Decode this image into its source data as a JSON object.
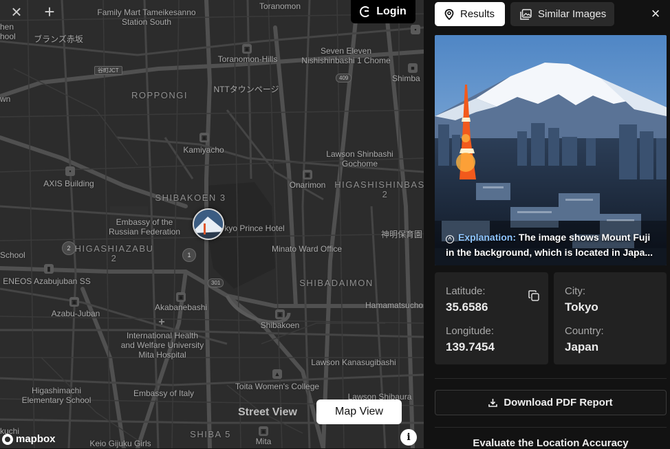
{
  "map": {
    "controls": {
      "close_icon": "close-icon",
      "add_icon": "plus-icon"
    },
    "login_label": "Login",
    "street_view_label": "Street View",
    "map_view_label": "Map View",
    "mapbox_label": "mapbox",
    "info_symbol": "i",
    "labels": {
      "family_mart": "Family Mart Tameikesanno\nStation South",
      "toranomon": "Toranomon",
      "hen": "hen",
      "school_top": "hool",
      "burands": "ブランズ赤坂",
      "toranomon_hills": "Toranomon-Hills",
      "seven_eleven": "Seven Eleven\nNishishinbashi 1 Chome",
      "shimba": "Shimba",
      "roppongi": "ROPPONGI",
      "ntt": "NTTタウンページ",
      "wn": "wn",
      "kamiyacho": "Kamiyacho",
      "lawson_shinbashi": "Lawson Shinbashi\nGochome",
      "axis": "AXIS Building",
      "onarimon": "Onarimon",
      "higashishinbashi": "HIGASHISHINBASHI\n2",
      "shibakoen3": "SHIBAKOEN 3",
      "embassy_fed": "Embassy of the\nRussian Federation",
      "prince_hotel": "kyo Prince Hotel",
      "jinmei": "神明保育園",
      "higashiazabu": "HIGASHIAZABU\n2",
      "minato_ward": "Minato Ward Office",
      "school_left": "School",
      "eneos": "ENEOS Azabujuban SS",
      "shibadaimon": "SHIBADAIMON",
      "akabanebashi": "Akabanebashi",
      "hamamatsucho": "Hamamatsucho",
      "azabu_juban": "Azabu-Juban",
      "shibakoen": "Shibakoen",
      "iuhw": "International Health\nand Welfare University\nMita Hospital",
      "lawson_kanasugi": "Lawson Kanasugibashi",
      "toita": "Toita Women's College",
      "higashimachi": "Higashimachi\nElementary School",
      "embassy_italy": "Embassy of Italy",
      "lawson_shibaura": "Lawson Shibaura",
      "kuchi": "kuchi",
      "keio": "Keio Gijuku Girls",
      "shiba5": "SHIBA 5",
      "mita": "Mita",
      "tanijct": "谷町JCT",
      "s409": "409",
      "s301": "301",
      "r1": "1",
      "r2": "2"
    }
  },
  "panel": {
    "tabs": {
      "results_label": "Results",
      "results_icon": "location-pin-icon",
      "similar_label": "Similar Images",
      "similar_icon": "images-icon"
    },
    "close_icon": "close-icon",
    "explanation_label": "Explanation:",
    "explanation_text": "The image shows Mount Fuji in the background, which is located in Japa...",
    "latitude_label": "Latitude:",
    "latitude_value": "35.6586",
    "longitude_label": "Longitude:",
    "longitude_value": "139.7454",
    "city_label": "City:",
    "city_value": "Tokyo",
    "country_label": "Country:",
    "country_value": "Japan",
    "download_label": "Download PDF Report",
    "download_icon": "download-icon",
    "evaluate_heading": "Evaluate the Location Accuracy"
  },
  "colors": {
    "map_bg": "#2c2c2c",
    "road": "#4a4a4a",
    "panel_bg": "#121212",
    "card_bg": "#222222",
    "explanation_accent": "#8ec5ff"
  }
}
